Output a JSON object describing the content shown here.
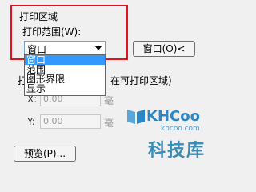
{
  "print_area": {
    "section_title": "打印区域",
    "range_label": "打印范围(W):",
    "selected_value": "窗口",
    "options": [
      "窗口",
      "范围",
      "图形界限",
      "显示"
    ],
    "window_button": "窗口(O)<"
  },
  "print_offset": {
    "title_prefix": "打",
    "title_suffix": "在可打印区域)",
    "x_label": "X:",
    "x_value": "0.00",
    "x_unit": "毫",
    "y_label": "Y:",
    "y_value": "0.00",
    "y_unit": "毫"
  },
  "preview_button": "预览(P)...",
  "watermark": {
    "brand": "KHCoo",
    "url": "khcoo.com",
    "text": "科技库"
  },
  "colors": {
    "highlight": "#e0141f",
    "selection": "#3399ff"
  }
}
